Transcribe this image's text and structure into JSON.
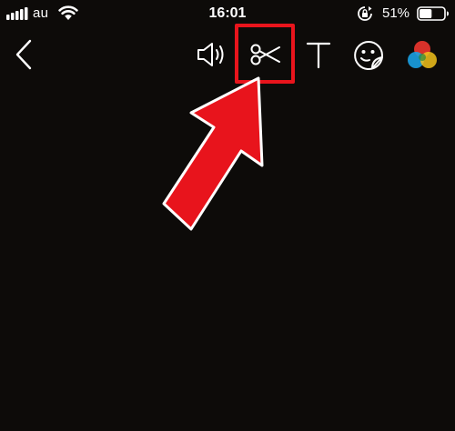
{
  "status_bar": {
    "carrier": "au",
    "time": "16:01",
    "battery_percent": "51%",
    "battery_level": 0.51,
    "icons": [
      "signal-icon",
      "wifi-icon",
      "rotation-lock-icon",
      "battery-icon"
    ]
  },
  "toolbar": {
    "tools": [
      {
        "name": "back",
        "icon": "chevron-left-icon"
      },
      {
        "name": "sound",
        "icon": "speaker-icon"
      },
      {
        "name": "trim",
        "icon": "scissors-icon"
      },
      {
        "name": "text",
        "icon": "text-t-icon"
      },
      {
        "name": "sticker",
        "icon": "sticker-face-icon"
      },
      {
        "name": "color-filter",
        "icon": "color-circles-icon"
      }
    ],
    "highlighted_tool": "trim"
  },
  "annotation": {
    "arrow_color": "#e8141c",
    "box_color": "#e8141c"
  },
  "colors": {
    "background": "#0d0b09",
    "foreground": "#ffffff"
  }
}
